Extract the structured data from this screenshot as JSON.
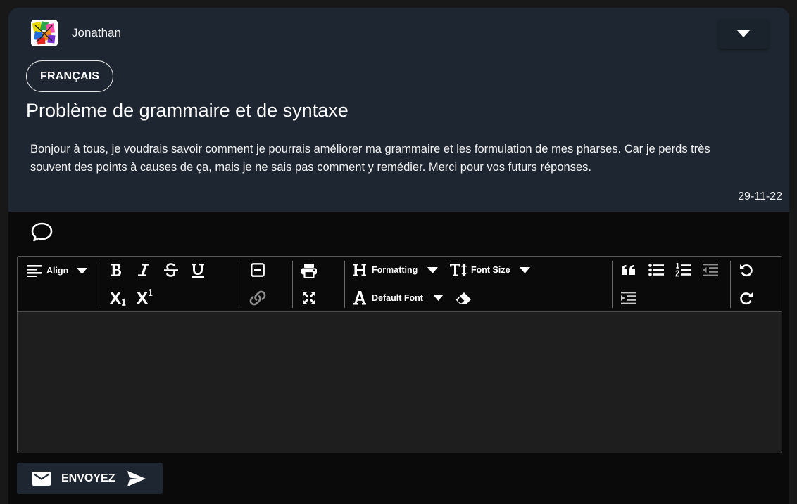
{
  "post": {
    "author": "Jonathan",
    "tag": "FRANÇAIS",
    "title": "Problème de grammaire et de syntaxe",
    "body": "Bonjour à tous, je voudrais savoir comment je pourrais améliorer ma grammaire et les formulation de mes pharses. Car je perds très souvent des points à causes de ça, mais je ne sais pas comment y remédier. Merci pour vos futurs réponses.",
    "date": "29-11-22"
  },
  "editor": {
    "toolbar": {
      "align_label": "Align",
      "formatting_label": "Formatting",
      "font_size_label": "Font Size",
      "default_font_label": "Default Font"
    },
    "content": ""
  },
  "send": {
    "label": "ENVOYEZ"
  },
  "colors": {
    "page_bg": "#181818",
    "post_bg": "#1e2731",
    "editor_bg": "#1e1e1e",
    "toolbar_bg": "#0a0a0a",
    "text": "#ffffff"
  }
}
